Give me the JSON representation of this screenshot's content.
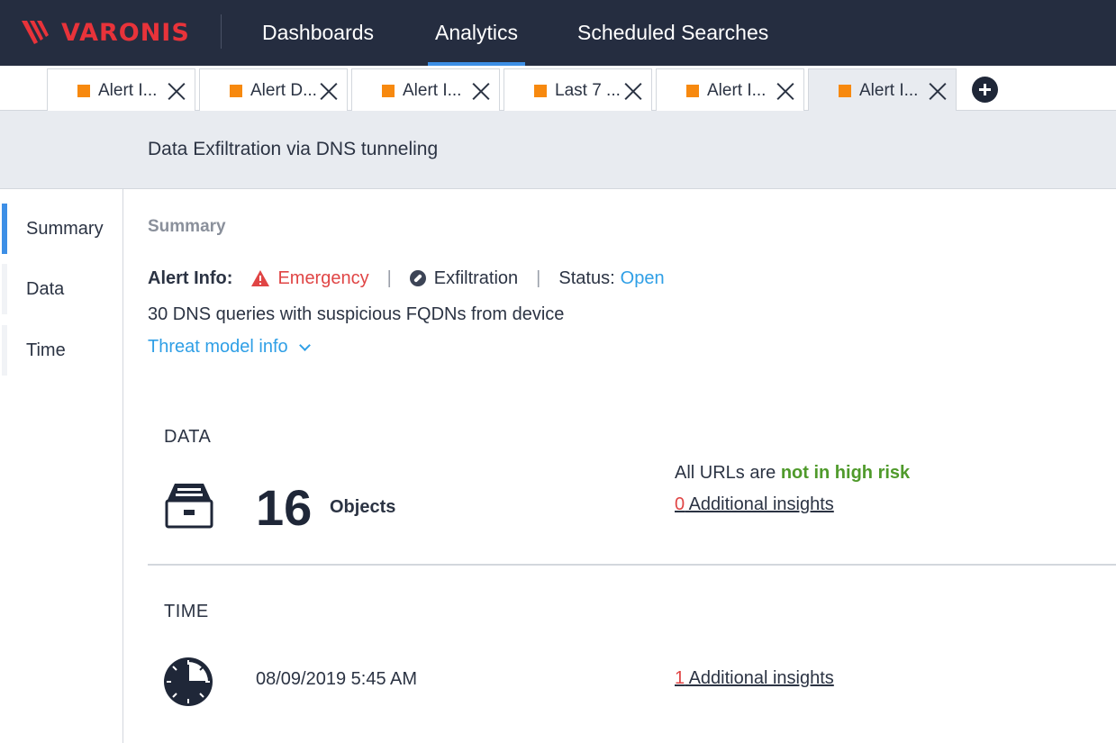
{
  "brand": {
    "name": "VARONIS",
    "accent": "#e8333a"
  },
  "nav": {
    "items": [
      {
        "label": "Dashboards",
        "active": false
      },
      {
        "label": "Analytics",
        "active": true
      },
      {
        "label": "Scheduled Searches",
        "active": false
      }
    ]
  },
  "tabs": [
    {
      "label": "Alert I...",
      "active": false
    },
    {
      "label": "Alert D...",
      "active": false
    },
    {
      "label": "Alert I...",
      "active": false
    },
    {
      "label": "Last 7 ...",
      "active": false
    },
    {
      "label": "Alert I...",
      "active": false
    },
    {
      "label": "Alert I...",
      "active": true
    }
  ],
  "page": {
    "title": "Data Exfiltration via DNS tunneling"
  },
  "sidenav": {
    "items": [
      {
        "label": "Summary",
        "active": true
      },
      {
        "label": "Data",
        "active": false
      },
      {
        "label": "Time",
        "active": false
      }
    ]
  },
  "summary": {
    "section_label": "Summary",
    "alert_info_label": "Alert Info:",
    "severity": "Emergency",
    "category": "Exfiltration",
    "status_label": "Status:",
    "status_value": "Open",
    "description": "30 DNS queries with suspicious FQDNs from device",
    "threat_model_link": "Threat model info"
  },
  "data_block": {
    "title": "DATA",
    "count": "16",
    "unit": "Objects",
    "urls_prefix": "All URLs are",
    "urls_status": "not in high risk",
    "insights_count": "0",
    "insights_label": " Additional insights"
  },
  "time_block": {
    "title": "TIME",
    "timestamp": "08/09/2019 5:45 AM",
    "insights_count": "1",
    "insights_label": " Additional insights"
  },
  "icons": {
    "logo": "varonis-logo-icon",
    "severity": "warning-triangle-icon",
    "category": "link-icon",
    "data": "file-drawer-icon",
    "time": "clock-icon",
    "add_tab": "plus-circle-icon",
    "close_tab": "close-icon"
  }
}
